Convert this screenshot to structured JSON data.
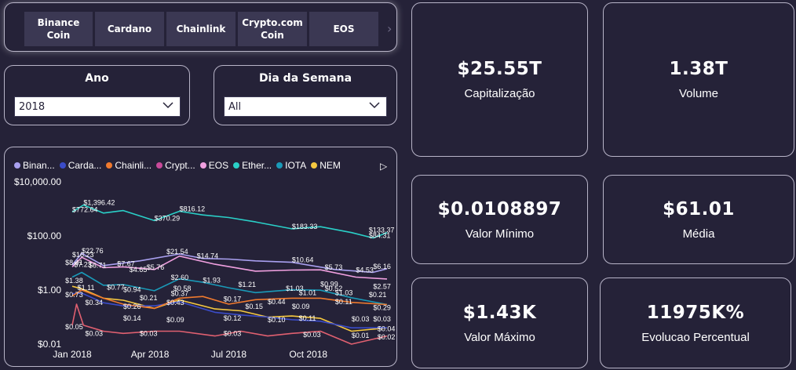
{
  "slicer": {
    "buttons": [
      {
        "label": "Binance\nCoin"
      },
      {
        "label": "Cardano"
      },
      {
        "label": "Chainlink"
      },
      {
        "label": "Crypto.com\nCoin"
      },
      {
        "label": "EOS"
      }
    ],
    "next_icon": "chevron-right-icon"
  },
  "filters": {
    "ano": {
      "title": "Ano",
      "value": "2018"
    },
    "dia": {
      "title": "Dia da Semana",
      "value": "All"
    }
  },
  "kpis": {
    "capitalizacao": {
      "value": "$25.55T",
      "label": "Capitalização"
    },
    "volume": {
      "value": "1.38T",
      "label": "Volume"
    },
    "valor_minimo": {
      "value": "$0.0108897",
      "label": "Valor Mínimo"
    },
    "media": {
      "value": "$61.01",
      "label": "Média"
    },
    "valor_maximo": {
      "value": "$1.43K",
      "label": "Valor Máximo"
    },
    "evolucao": {
      "value": "11975K%",
      "label": "Evolucao Percentual"
    }
  },
  "chart_data": {
    "type": "line",
    "y_scale": "log",
    "y_ticks": [
      "$10,000.00",
      "$100.00",
      "$1.00",
      "$0.01"
    ],
    "y_tick_values": [
      10000,
      100,
      1,
      0.01
    ],
    "x_ticks": [
      "Jan 2018",
      "Apr 2018",
      "Jul 2018",
      "Oct 2018"
    ],
    "x_tick_dates": [
      "2018-01-01",
      "2018-04-01",
      "2018-07-01",
      "2018-10-01"
    ],
    "x_range": [
      "2018-01-01",
      "2018-12-31"
    ],
    "grid": false,
    "legend_position": "top",
    "legend": [
      {
        "label": "Binan...",
        "color": "#a9a0f0"
      },
      {
        "label": "Carda...",
        "color": "#3b4cc8"
      },
      {
        "label": "Chainli...",
        "color": "#f07a2e"
      },
      {
        "label": "Crypt...",
        "color": "#c94a9a"
      },
      {
        "label": "EOS",
        "color": "#f0a0e0"
      },
      {
        "label": "Ether...",
        "color": "#2ad0c8"
      },
      {
        "label": "IOTA",
        "color": "#1a9ab8"
      },
      {
        "label": "NEM",
        "color": "#f5c840"
      }
    ],
    "series": [
      {
        "name": "Ether...",
        "color": "#2ad0c8",
        "points": [
          [
            "2018-01-01",
            772.64
          ],
          [
            "2018-01-14",
            1396.42
          ],
          [
            "2018-02-06",
            700
          ],
          [
            "2018-03-01",
            870
          ],
          [
            "2018-04-06",
            370.29
          ],
          [
            "2018-05-05",
            816.12
          ],
          [
            "2018-06-01",
            600
          ],
          [
            "2018-07-01",
            480
          ],
          [
            "2018-08-01",
            330
          ],
          [
            "2018-09-12",
            183.33
          ],
          [
            "2018-10-15",
            220
          ],
          [
            "2018-11-20",
            133.37
          ],
          [
            "2018-12-15",
            84.31
          ],
          [
            "2018-12-31",
            133.37
          ]
        ]
      },
      {
        "name": "Binan...",
        "color": "#a9a0f0",
        "points": [
          [
            "2018-01-01",
            8.41
          ],
          [
            "2018-01-12",
            22.76
          ],
          [
            "2018-02-06",
            8
          ],
          [
            "2018-03-20",
            12
          ],
          [
            "2018-05-05",
            21.54
          ],
          [
            "2018-06-01",
            14.74
          ],
          [
            "2018-07-01",
            14
          ],
          [
            "2018-08-01",
            12
          ],
          [
            "2018-09-12",
            10.64
          ],
          [
            "2018-11-01",
            5.73
          ],
          [
            "2018-12-15",
            4.53
          ],
          [
            "2018-12-31",
            6.16
          ]
        ]
      },
      {
        "name": "EOS",
        "color": "#f0a0e0",
        "points": [
          [
            "2018-01-01",
            7.23
          ],
          [
            "2018-01-12",
            16.23
          ],
          [
            "2018-02-06",
            6.71
          ],
          [
            "2018-03-01",
            7.2
          ],
          [
            "2018-04-06",
            5.76
          ],
          [
            "2018-05-05",
            18
          ],
          [
            "2018-06-15",
            9
          ],
          [
            "2018-08-01",
            5
          ],
          [
            "2018-09-12",
            5.5
          ],
          [
            "2018-10-15",
            5.6
          ],
          [
            "2018-11-25",
            3
          ],
          [
            "2018-12-31",
            2.57
          ]
        ]
      },
      {
        "name": "IOTA",
        "color": "#1a9ab8",
        "points": [
          [
            "2018-01-01",
            3
          ],
          [
            "2018-01-12",
            4.5
          ],
          [
            "2018-02-06",
            1.5
          ],
          [
            "2018-03-01",
            1.6
          ],
          [
            "2018-04-06",
            0.94
          ],
          [
            "2018-05-05",
            2.6
          ],
          [
            "2018-06-01",
            1.93
          ],
          [
            "2018-07-01",
            1.21
          ],
          [
            "2018-08-01",
            0.8
          ],
          [
            "2018-09-12",
            1.03
          ],
          [
            "2018-10-15",
            0.99
          ],
          [
            "2018-11-20",
            0.52
          ],
          [
            "2018-12-31",
            0.29
          ]
        ]
      },
      {
        "name": "NEM",
        "color": "#f5c840",
        "points": [
          [
            "2018-01-01",
            1.38
          ],
          [
            "2018-01-12",
            1.11
          ],
          [
            "2018-02-06",
            0.5
          ],
          [
            "2018-03-01",
            0.42
          ],
          [
            "2018-04-06",
            0.21
          ],
          [
            "2018-05-05",
            0.43
          ],
          [
            "2018-06-15",
            0.2
          ],
          [
            "2018-07-15",
            0.17
          ],
          [
            "2018-08-15",
            0.1
          ],
          [
            "2018-09-12",
            0.11
          ],
          [
            "2018-10-15",
            0.09
          ],
          [
            "2018-11-20",
            0.03
          ],
          [
            "2018-12-31",
            0.04
          ]
        ]
      },
      {
        "name": "Carda...",
        "color": "#3b4cc8",
        "points": [
          [
            "2018-01-01",
            0.73
          ],
          [
            "2018-01-12",
            0.77
          ],
          [
            "2018-02-06",
            0.34
          ],
          [
            "2018-03-01",
            0.26
          ],
          [
            "2018-04-06",
            0.26
          ],
          [
            "2018-05-05",
            0.37
          ],
          [
            "2018-06-15",
            0.15
          ],
          [
            "2018-07-15",
            0.12
          ],
          [
            "2018-08-15",
            0.1
          ],
          [
            "2018-09-12",
            0.08
          ],
          [
            "2018-10-15",
            0.07
          ],
          [
            "2018-11-20",
            0.04
          ],
          [
            "2018-12-31",
            0.04
          ]
        ]
      },
      {
        "name": "Chainli...",
        "color": "#f07a2e",
        "points": [
          [
            "2018-01-01",
            0.6
          ],
          [
            "2018-01-12",
            1.0
          ],
          [
            "2018-02-06",
            0.5
          ],
          [
            "2018-03-01",
            0.3
          ],
          [
            "2018-04-06",
            0.21
          ],
          [
            "2018-05-05",
            0.5
          ],
          [
            "2018-06-01",
            0.58
          ],
          [
            "2018-07-01",
            0.3
          ],
          [
            "2018-08-01",
            0.44
          ],
          [
            "2018-09-12",
            0.5
          ],
          [
            "2018-10-15",
            0.5
          ],
          [
            "2018-11-20",
            0.35
          ],
          [
            "2018-12-31",
            0.29
          ]
        ]
      },
      {
        "name": "Crypt...",
        "color": "#e06070",
        "points": [
          [
            "2018-01-01",
            0.05
          ],
          [
            "2018-01-06",
            0.3
          ],
          [
            "2018-01-14",
            0.05
          ],
          [
            "2018-02-06",
            0.03
          ],
          [
            "2018-03-01",
            0.025
          ],
          [
            "2018-04-06",
            0.03
          ],
          [
            "2018-05-05",
            0.03
          ],
          [
            "2018-06-15",
            0.02
          ],
          [
            "2018-07-15",
            0.03
          ],
          [
            "2018-08-15",
            0.02
          ],
          [
            "2018-09-12",
            0.025
          ],
          [
            "2018-10-15",
            0.03
          ],
          [
            "2018-11-20",
            0.01
          ],
          [
            "2018-12-31",
            0.02
          ]
        ]
      }
    ],
    "data_labels": [
      {
        "text": "$1,396.42",
        "date": "2018-01-14",
        "value": 1396.42,
        "color": "#fff"
      },
      {
        "text": "$816.12",
        "date": "2018-05-05",
        "value": 816.12,
        "color": "#fff"
      },
      {
        "text": "$772.64",
        "date": "2018-01-01",
        "value": 772.64,
        "color": "#fff"
      },
      {
        "text": "$370.29",
        "date": "2018-04-06",
        "value": 370.29,
        "color": "#fff"
      },
      {
        "text": "$183.33",
        "date": "2018-09-12",
        "value": 183.33,
        "color": "#fff"
      },
      {
        "text": "$133.37",
        "date": "2018-12-10",
        "value": 133.37,
        "color": "#fff"
      },
      {
        "text": "$84.31",
        "date": "2018-12-10",
        "value": 84.31,
        "color": "#fff"
      },
      {
        "text": "$22.76",
        "date": "2018-01-12",
        "value": 22.76,
        "color": "#fff"
      },
      {
        "text": "$21.54",
        "date": "2018-04-20",
        "value": 21.54,
        "color": "#fff"
      },
      {
        "text": "$14.74",
        "date": "2018-05-25",
        "value": 14.74,
        "color": "#fff"
      },
      {
        "text": "$10.64",
        "date": "2018-09-12",
        "value": 10.64,
        "color": "#fff"
      },
      {
        "text": "$5.73",
        "date": "2018-10-20",
        "value": 5.73,
        "color": "#fff"
      },
      {
        "text": "$6.16",
        "date": "2018-12-15",
        "value": 6.16,
        "color": "#fff"
      },
      {
        "text": "$16.23",
        "date": "2018-01-01",
        "value": 16.23,
        "color": "#fff"
      },
      {
        "text": "$8.41",
        "date": "2017-12-24",
        "value": 8.41,
        "color": "#fff"
      },
      {
        "text": "$7.23",
        "date": "2018-01-03",
        "value": 7.23,
        "color": "#fff"
      },
      {
        "text": "$6.71",
        "date": "2018-01-20",
        "value": 6.71,
        "color": "#fff"
      },
      {
        "text": "$7.67",
        "date": "2018-02-22",
        "value": 7.67,
        "color": "#fff"
      },
      {
        "text": "$5.76",
        "date": "2018-03-28",
        "value": 5.76,
        "color": "#fff"
      },
      {
        "text": "$4.65",
        "date": "2018-03-08",
        "value": 4.65,
        "color": "#fff"
      },
      {
        "text": "$4.53",
        "date": "2018-11-25",
        "value": 4.53,
        "color": "#fff"
      },
      {
        "text": "$1.38",
        "date": "2017-12-24",
        "value": 1.8,
        "color": "#fff"
      },
      {
        "text": "$1.11",
        "date": "2018-01-07",
        "value": 1.0,
        "color": "#fff"
      },
      {
        "text": "$0.77",
        "date": "2018-02-10",
        "value": 1.05,
        "color": "#fff"
      },
      {
        "text": "$2.60",
        "date": "2018-04-25",
        "value": 2.4,
        "color": "#fff"
      },
      {
        "text": "$1.93",
        "date": "2018-06-01",
        "value": 1.9,
        "color": "#fff"
      },
      {
        "text": "$1.21",
        "date": "2018-07-12",
        "value": 1.3,
        "color": "#fff"
      },
      {
        "text": "$1.03",
        "date": "2018-09-05",
        "value": 0.95,
        "color": "#fff"
      },
      {
        "text": "$0.99",
        "date": "2018-10-15",
        "value": 1.35,
        "color": "#fff"
      },
      {
        "text": "$0.52",
        "date": "2018-10-20",
        "value": 0.95,
        "color": "#fff"
      },
      {
        "text": "$2.57",
        "date": "2018-12-15",
        "value": 1.1,
        "color": "#fff"
      },
      {
        "text": "$0.94",
        "date": "2018-03-01",
        "value": 0.85,
        "color": "#fff"
      },
      {
        "text": "$0.58",
        "date": "2018-04-28",
        "value": 0.95,
        "color": "#fff"
      },
      {
        "text": "$1.01",
        "date": "2018-09-20",
        "value": 0.65,
        "color": "#fff"
      },
      {
        "text": "$1.03",
        "date": "2018-11-01",
        "value": 0.65,
        "color": "#fff"
      },
      {
        "text": "$0.21",
        "date": "2018-12-10",
        "value": 0.55,
        "color": "#fff"
      },
      {
        "text": "$0.73",
        "date": "2017-12-24",
        "value": 0.55,
        "color": "#fff"
      },
      {
        "text": "$0.34",
        "date": "2018-01-16",
        "value": 0.28,
        "color": "#fff"
      },
      {
        "text": "$0.21",
        "date": "2018-03-20",
        "value": 0.42,
        "color": "#fff"
      },
      {
        "text": "$0.37",
        "date": "2018-04-25",
        "value": 0.6,
        "color": "#fff"
      },
      {
        "text": "$0.43",
        "date": "2018-04-20",
        "value": 0.28,
        "color": "#fff"
      },
      {
        "text": "$0.26",
        "date": "2018-03-01",
        "value": 0.2,
        "color": "#fff"
      },
      {
        "text": "$0.17",
        "date": "2018-06-25",
        "value": 0.38,
        "color": "#fff"
      },
      {
        "text": "$0.15",
        "date": "2018-07-20",
        "value": 0.2,
        "color": "#fff"
      },
      {
        "text": "$0.44",
        "date": "2018-08-15",
        "value": 0.3,
        "color": "#fff"
      },
      {
        "text": "$0.09",
        "date": "2018-09-12",
        "value": 0.2,
        "color": "#fff"
      },
      {
        "text": "$0.11",
        "date": "2018-11-01",
        "value": 0.3,
        "color": "#fff"
      },
      {
        "text": "$0.29",
        "date": "2018-12-15",
        "value": 0.18,
        "color": "#fff"
      },
      {
        "text": "$0.14",
        "date": "2018-03-01",
        "value": 0.075,
        "color": "#fff"
      },
      {
        "text": "$0.09",
        "date": "2018-04-20",
        "value": 0.065,
        "color": "#fff"
      },
      {
        "text": "$0.12",
        "date": "2018-06-25",
        "value": 0.075,
        "color": "#fff"
      },
      {
        "text": "$0.10",
        "date": "2018-08-15",
        "value": 0.065,
        "color": "#fff"
      },
      {
        "text": "$0.11",
        "date": "2018-09-20",
        "value": 0.075,
        "color": "#fff"
      },
      {
        "text": "$0.03",
        "date": "2018-11-20",
        "value": 0.07,
        "color": "#fff"
      },
      {
        "text": "$0.03",
        "date": "2018-12-15",
        "value": 0.07,
        "color": "#fff"
      },
      {
        "text": "$0.05",
        "date": "2017-12-24",
        "value": 0.035,
        "color": "#fff"
      },
      {
        "text": "$0.03",
        "date": "2018-01-16",
        "value": 0.02,
        "color": "#fff"
      },
      {
        "text": "$0.03",
        "date": "2018-03-20",
        "value": 0.02,
        "color": "#fff"
      },
      {
        "text": "$0.03",
        "date": "2018-06-25",
        "value": 0.02,
        "color": "#fff"
      },
      {
        "text": "$0.03",
        "date": "2018-09-25",
        "value": 0.018,
        "color": "#fff"
      },
      {
        "text": "$0.01",
        "date": "2018-11-20",
        "value": 0.017,
        "color": "#fff"
      },
      {
        "text": "$0.04",
        "date": "2018-12-20",
        "value": 0.03,
        "color": "#fff"
      },
      {
        "text": "$0.02",
        "date": "2018-12-20",
        "value": 0.015,
        "color": "#fff"
      }
    ]
  },
  "colors": {
    "background": "#252238",
    "button": "#3b3853",
    "border": "#b8b4c8"
  }
}
